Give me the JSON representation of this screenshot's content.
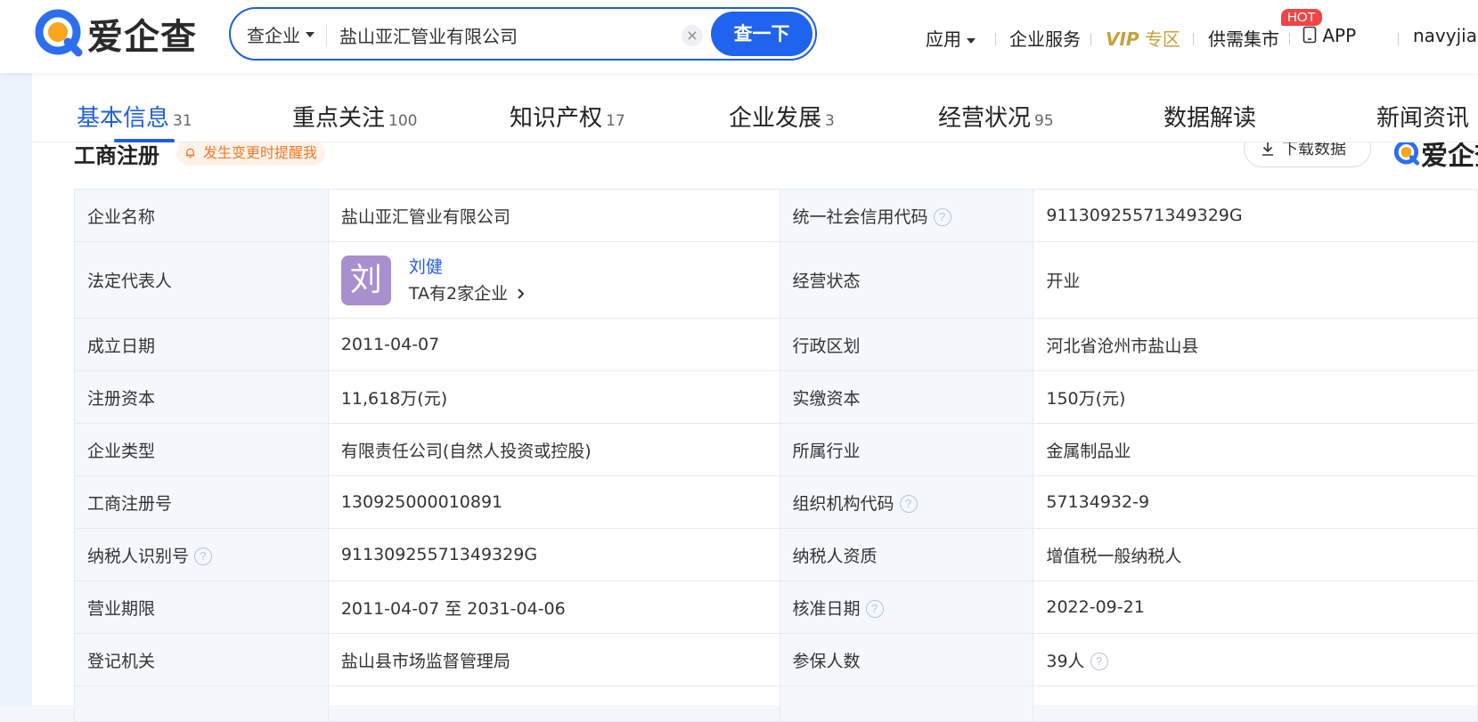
{
  "header": {
    "logo_text": "爱企查",
    "search": {
      "type_label": "查企业",
      "value": "盐山亚汇管业有限公司",
      "clear_label": "×",
      "button_label": "查一下"
    },
    "nav": {
      "apps": "应用",
      "services": "企业服务",
      "vip_prefix": "VIP",
      "vip_suffix": "专区",
      "market": "供需集市",
      "hot_badge": "HOT",
      "app": "APP",
      "user": "navyjian"
    }
  },
  "tabs": [
    {
      "label": "基本信息",
      "count": "31"
    },
    {
      "label": "重点关注",
      "count": "100"
    },
    {
      "label": "知识产权",
      "count": "17"
    },
    {
      "label": "企业发展",
      "count": "3"
    },
    {
      "label": "经营状况",
      "count": "95"
    },
    {
      "label": "数据解读",
      "count": ""
    },
    {
      "label": "新闻资讯",
      "count": ""
    }
  ],
  "section": {
    "title": "工商注册",
    "remind_label": "发生变更时提醒我",
    "download_label": "下载数据",
    "brand": "爱企查"
  },
  "table": {
    "company_name_label": "企业名称",
    "company_name": "盐山亚汇管业有限公司",
    "credit_code_label": "统一社会信用代码",
    "credit_code": "91130925571349329G",
    "legal_rep_label": "法定代表人",
    "legal_rep_avatar": "刘",
    "legal_rep_name": "刘健",
    "legal_rep_link": "TA有2家企业",
    "status_label": "经营状态",
    "status": "开业",
    "founded_label": "成立日期",
    "founded": "2011-04-07",
    "region_label": "行政区划",
    "region": "河北省沧州市盐山县",
    "reg_capital_label": "注册资本",
    "reg_capital": "11,618万(元)",
    "paid_capital_label": "实缴资本",
    "paid_capital": "150万(元)",
    "type_label": "企业类型",
    "type": "有限责任公司(自然人投资或控股)",
    "industry_label": "所属行业",
    "industry": "金属制品业",
    "reg_no_label": "工商注册号",
    "reg_no": "130925000010891",
    "org_code_label": "组织机构代码",
    "org_code": "57134932-9",
    "taxpayer_id_label": "纳税人识别号",
    "taxpayer_id": "91130925571349329G",
    "taxpayer_type_label": "纳税人资质",
    "taxpayer_type": "增值税一般纳税人",
    "term_label": "营业期限",
    "term": "2011-04-07 至 2031-04-06",
    "approve_date_label": "核准日期",
    "approve_date": "2022-09-21",
    "authority_label": "登记机关",
    "authority": "盐山县市场监督管理局",
    "insured_label": "参保人数",
    "insured": "39人"
  }
}
